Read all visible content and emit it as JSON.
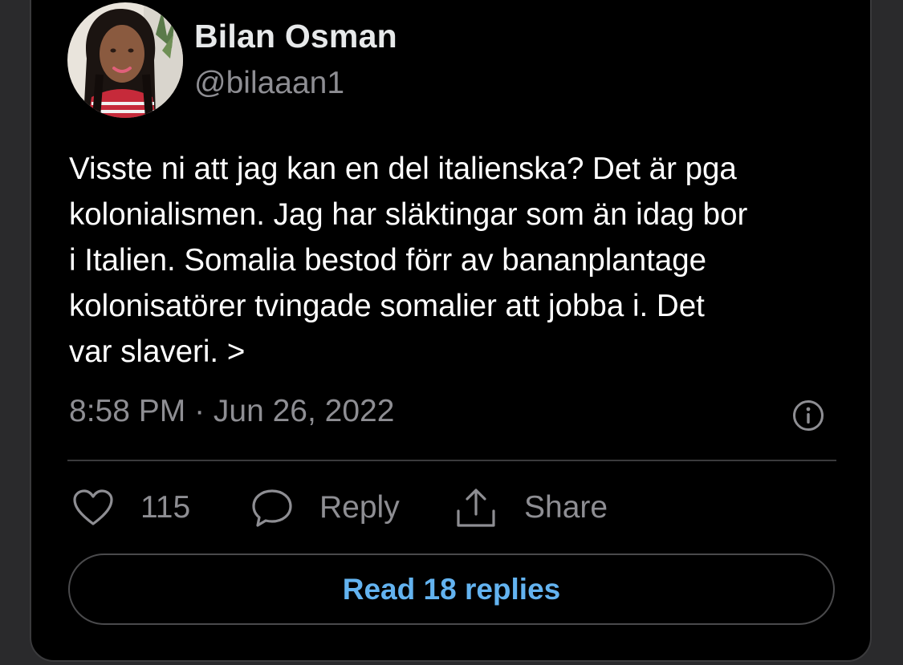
{
  "tweet": {
    "author_name": "Bilan Osman",
    "author_handle": "@bilaaan1",
    "text_lines": [
      "Visste ni att jag kan en del italienska? Det är pga",
      "kolonialismen. Jag har släktingar som än idag bor",
      "i Italien. Somalia bestod förr av bananplantage",
      "kolonisatörer tvingade somalier att jobba i. Det",
      "var slaveri. >"
    ],
    "timestamp": "8:58 PM · Jun 26, 2022"
  },
  "actions": {
    "like_count": "115",
    "reply_label": "Reply",
    "share_label": "Share",
    "read_replies_label": "Read 18 replies"
  },
  "icons": {
    "info": "info-circle-icon",
    "like": "heart-icon",
    "reply": "speech-bubble-icon",
    "share": "share-upload-icon"
  },
  "colors": {
    "background": "#000000",
    "text_primary": "#ffffff",
    "text_secondary": "#8e8e93",
    "link": "#63b3f0"
  }
}
